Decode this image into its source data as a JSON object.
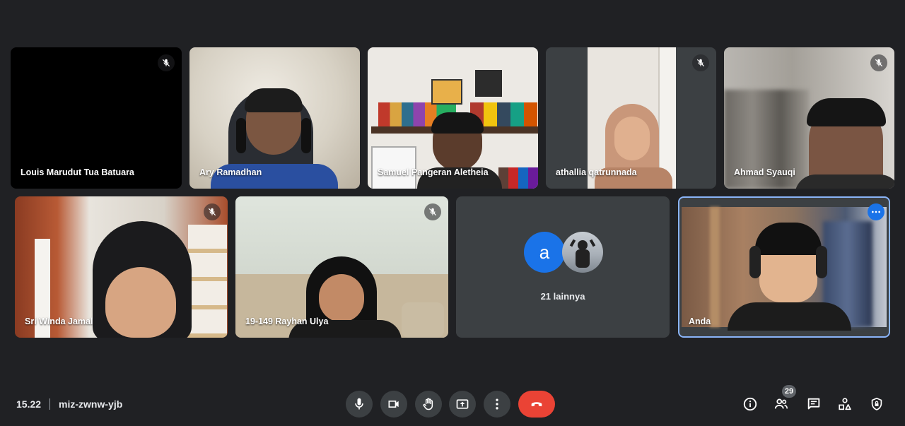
{
  "participants": [
    {
      "name": "Louis Marudut Tua Batuara",
      "muted": true
    },
    {
      "name": "Ary Ramadhan",
      "muted": false
    },
    {
      "name": "Samuel Pangeran Aletheia",
      "muted": false
    },
    {
      "name": "athallia qatrunnada",
      "muted": true
    },
    {
      "name": "Ahmad Syauqi",
      "muted": true
    },
    {
      "name": "Sri Winda Jamal",
      "muted": true
    },
    {
      "name": "19-149 Rayhan Ulya",
      "muted": true
    },
    {
      "name": "Anda",
      "muted": false
    }
  ],
  "others": {
    "avatar_letter": "a",
    "label": "21 lainnya"
  },
  "meeting": {
    "time": "15.22",
    "code": "miz-zwnw-yjb"
  },
  "people_count": "29",
  "colors": {
    "background": "#202124",
    "tile": "#3c4043",
    "accent": "#1a73e8",
    "hangup": "#ea4335",
    "selected_border": "#8ab4f8"
  },
  "icons": [
    "mic-off-icon",
    "mic-icon",
    "camera-icon",
    "raise-hand-icon",
    "present-icon",
    "more-icon",
    "hangup-icon",
    "info-icon",
    "people-icon",
    "chat-icon",
    "activities-icon",
    "host-controls-icon"
  ]
}
